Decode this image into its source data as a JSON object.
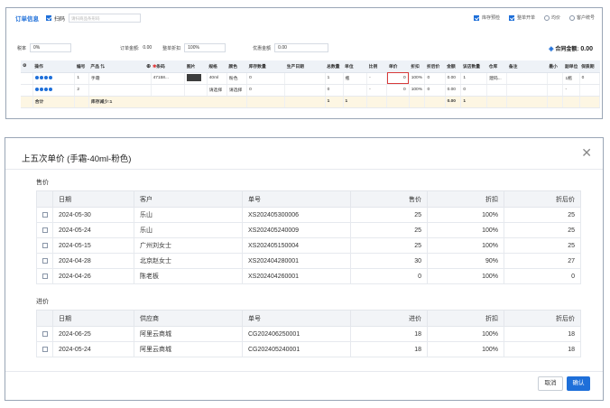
{
  "order": {
    "title": "订单信息",
    "scan_label": "扫码",
    "scan_placeholder": "请扫商品条形码",
    "options": [
      "库存预检",
      "整单开单",
      "均价",
      "客户统号"
    ],
    "options_checked": [
      true,
      true,
      false,
      false
    ],
    "tax_label": "税率",
    "tax_value": "0%",
    "order_amount_label": "订单金额:",
    "order_amount_value": "0.00",
    "discount_label": "整单折扣",
    "discount_value": "100%",
    "preferential_label": "优惠金额",
    "preferential_value": "0.00",
    "total_label": "合同金额:",
    "total_value": "0.00",
    "columns": [
      "操作",
      "编号",
      "产品",
      "条码",
      "图片",
      "规格",
      "颜色",
      "库存数量",
      "生产日期",
      "总数量",
      "单位",
      "比例",
      "单价",
      "折扣",
      "折后价",
      "金额",
      "该店数量",
      "仓库",
      "备注",
      "最小",
      "副单位",
      "保质期"
    ],
    "rows": [
      {
        "no": "1",
        "product": "手霜",
        "barcode": "47158...",
        "spec": "40ml",
        "color": "粉色",
        "stock": "0",
        "qty": "1",
        "unit": "瓶",
        "ratio": "-",
        "price": "0",
        "discount": "100%",
        "after": "0",
        "amount": "0.00",
        "shop_qty": "1",
        "warehouse": "建码...",
        "sub_unit": "1瓶",
        "shelf": "0"
      },
      {
        "no": "2",
        "product": "",
        "barcode": "",
        "spec": "请选择",
        "color": "请选择",
        "stock": "0",
        "qty": "0",
        "unit": "",
        "ratio": "-",
        "price": "0",
        "discount": "100%",
        "after": "0",
        "amount": "0.00",
        "shop_qty": "0",
        "warehouse": "",
        "sub_unit": "-",
        "shelf": ""
      }
    ],
    "sum": {
      "label": "合计",
      "stock_note": "库存减少:1",
      "qty": "1",
      "unit": "1",
      "amount": "0.00",
      "shop_qty": "1"
    }
  },
  "dialog": {
    "title": "上五次单价 (手霜-40ml-粉色)",
    "sale_section": "售价",
    "sale_headers": [
      "日期",
      "客户",
      "单号",
      "售价",
      "折扣",
      "折后价"
    ],
    "sale_rows": [
      [
        "2024-05-30",
        "乐山",
        "XS202405300006",
        "25",
        "100%",
        "25"
      ],
      [
        "2024-05-24",
        "乐山",
        "XS202405240009",
        "25",
        "100%",
        "25"
      ],
      [
        "2024-05-15",
        "广州刘女士",
        "XS202405150004",
        "25",
        "100%",
        "25"
      ],
      [
        "2024-04-28",
        "北京赵女士",
        "XS202404280001",
        "30",
        "90%",
        "27"
      ],
      [
        "2024-04-26",
        "陈老板",
        "XS202404260001",
        "0",
        "100%",
        "0"
      ]
    ],
    "purchase_section": "进价",
    "purchase_headers": [
      "日期",
      "供应商",
      "单号",
      "进价",
      "折扣",
      "折后价"
    ],
    "purchase_rows": [
      [
        "2024-06-25",
        "阿里云商城",
        "CG202406250001",
        "18",
        "100%",
        "18"
      ],
      [
        "2024-05-24",
        "阿里云商城",
        "CG202405240001",
        "18",
        "100%",
        "18"
      ]
    ],
    "cancel_label": "取消",
    "confirm_label": "确认"
  },
  "colors": {
    "accent": "#1e6fd9",
    "warning": "#e23b3b"
  }
}
